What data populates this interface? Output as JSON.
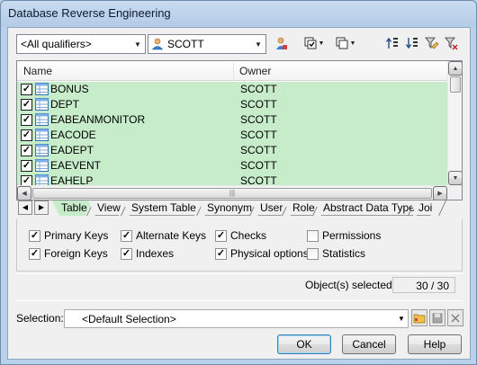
{
  "window": {
    "title": "Database Reverse Engineering"
  },
  "toolbar": {
    "qualifier": "<All qualifiers>",
    "owner": "SCOTT",
    "icons": [
      "user-icon",
      "select-all-icon",
      "deselect-icon",
      "move-to-top-icon",
      "move-to-bottom-icon",
      "filter-icon",
      "clear-filter-icon"
    ]
  },
  "list": {
    "columns": {
      "name": "Name",
      "owner": "Owner"
    },
    "rows": [
      {
        "name": "BONUS",
        "owner": "SCOTT",
        "checked": true
      },
      {
        "name": "DEPT",
        "owner": "SCOTT",
        "checked": true
      },
      {
        "name": "EABEANMONITOR",
        "owner": "SCOTT",
        "checked": true
      },
      {
        "name": "EACODE",
        "owner": "SCOTT",
        "checked": true
      },
      {
        "name": "EADEPT",
        "owner": "SCOTT",
        "checked": true
      },
      {
        "name": "EAEVENT",
        "owner": "SCOTT",
        "checked": true
      },
      {
        "name": "EAHELP",
        "owner": "SCOTT",
        "checked": true
      }
    ],
    "row_color": "#c6ecca"
  },
  "tabs": {
    "items": [
      "Table",
      "View",
      "System Table",
      "Synonym",
      "User",
      "Role",
      "Abstract Data Type",
      "Joi"
    ],
    "active": "Table"
  },
  "options": {
    "primary_keys": "Primary Keys",
    "foreign_keys": "Foreign Keys",
    "alternate_keys": "Alternate Keys",
    "indexes": "Indexes",
    "checks": "Checks",
    "physical_options": "Physical options",
    "permissions": "Permissions",
    "statistics": "Statistics"
  },
  "status": {
    "label": "Object(s) selected:",
    "value": "30 / 30"
  },
  "selection": {
    "label": "Selection:",
    "value": "<Default Selection>"
  },
  "buttons": {
    "ok": "OK",
    "cancel": "Cancel",
    "help": "Help"
  }
}
